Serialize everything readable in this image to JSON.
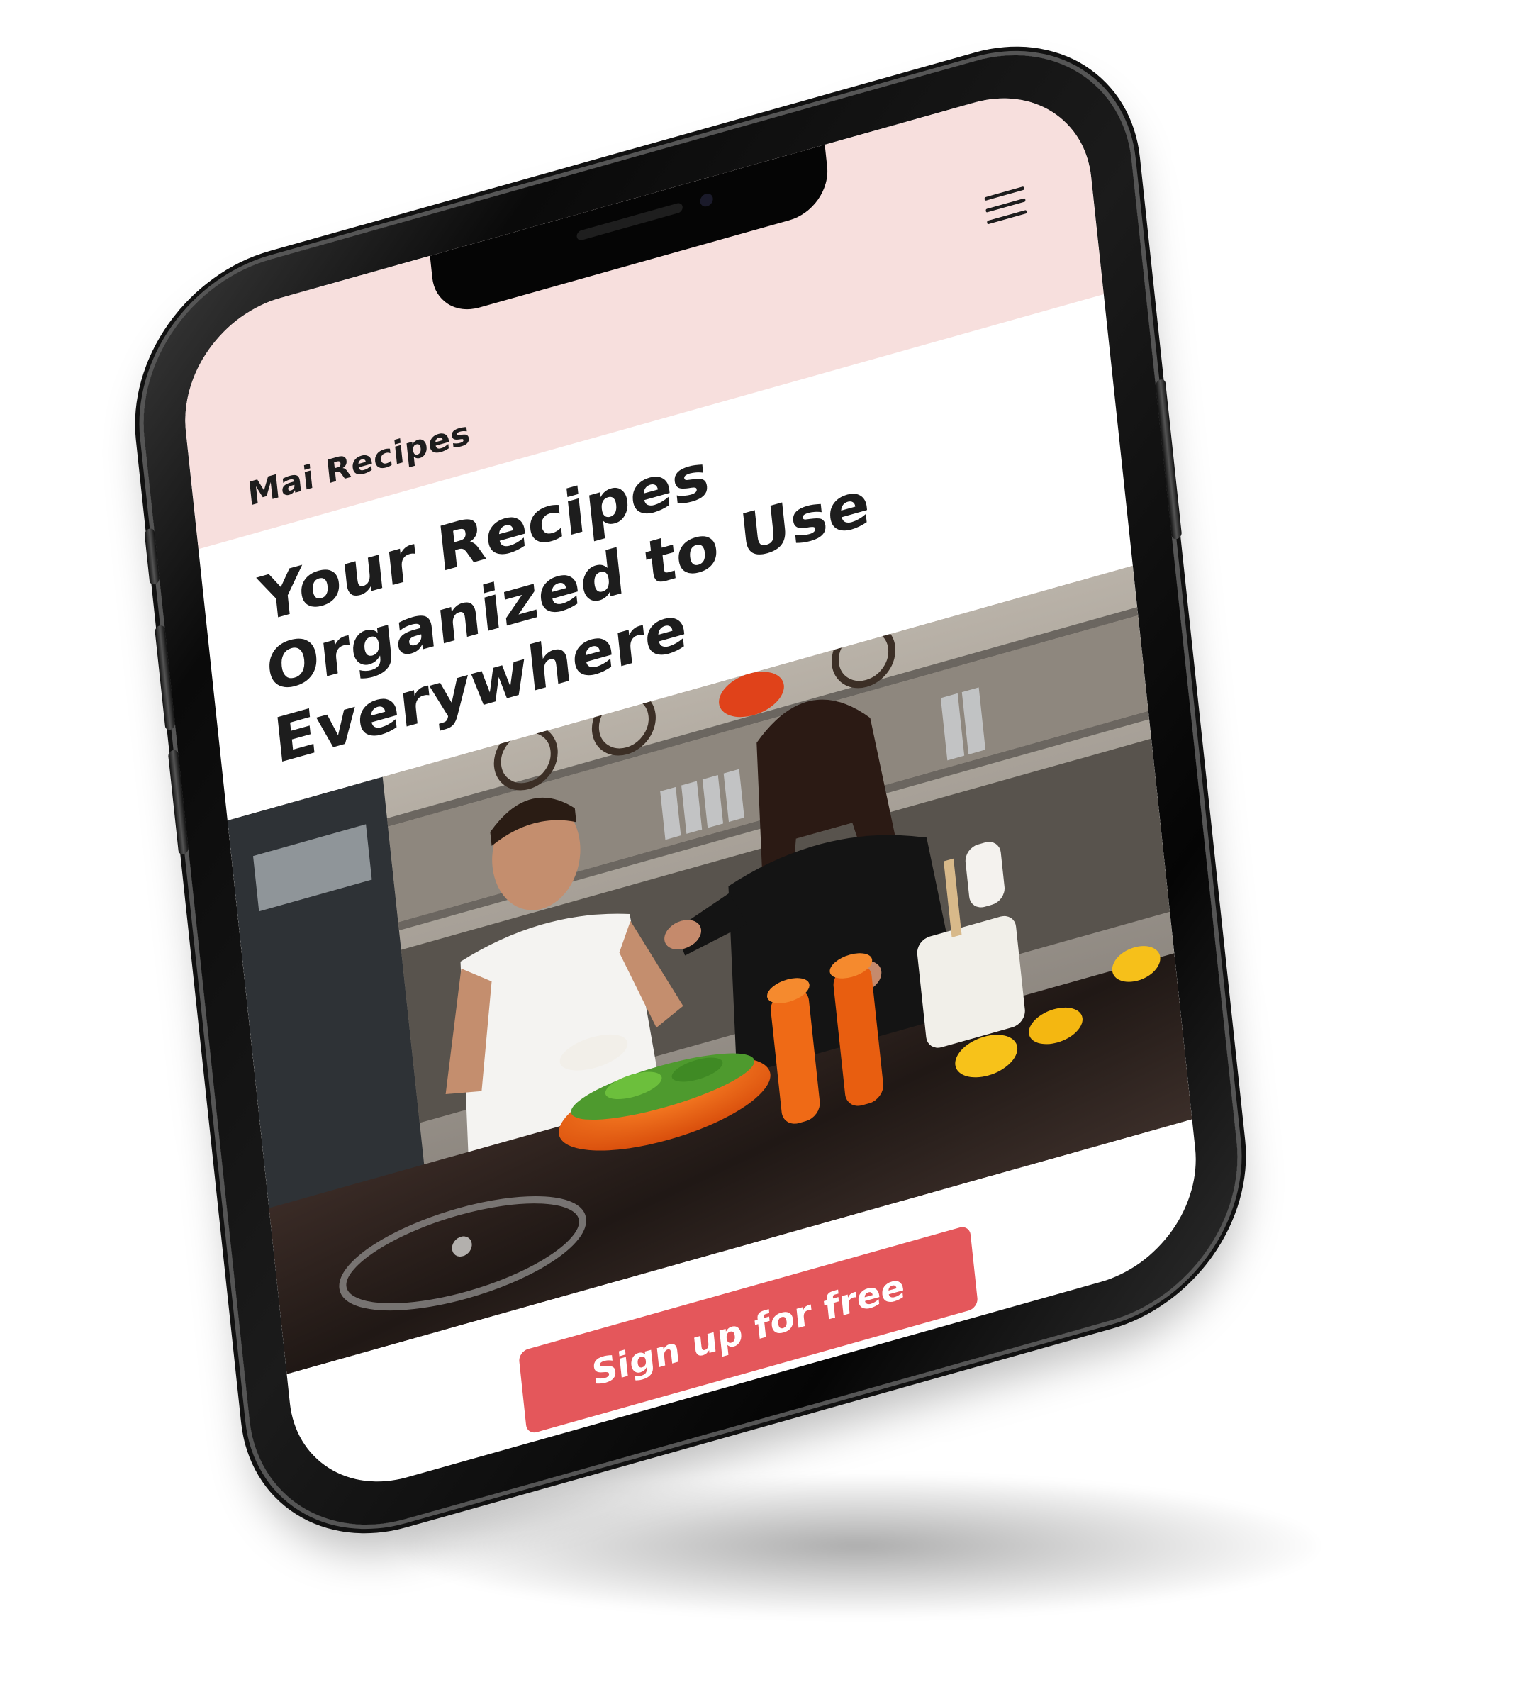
{
  "app": {
    "brand": "Mai Recipes",
    "menu_icon": "hamburger-menu-icon"
  },
  "hero": {
    "headline_lines": [
      "Your Recipes",
      "Organized to Use",
      "Everywhere"
    ]
  },
  "cta": {
    "label": "Sign up for free"
  },
  "colors": {
    "header_background": "#f7dfdd",
    "accent": "#e4575b",
    "text": "#1d1d1d"
  }
}
